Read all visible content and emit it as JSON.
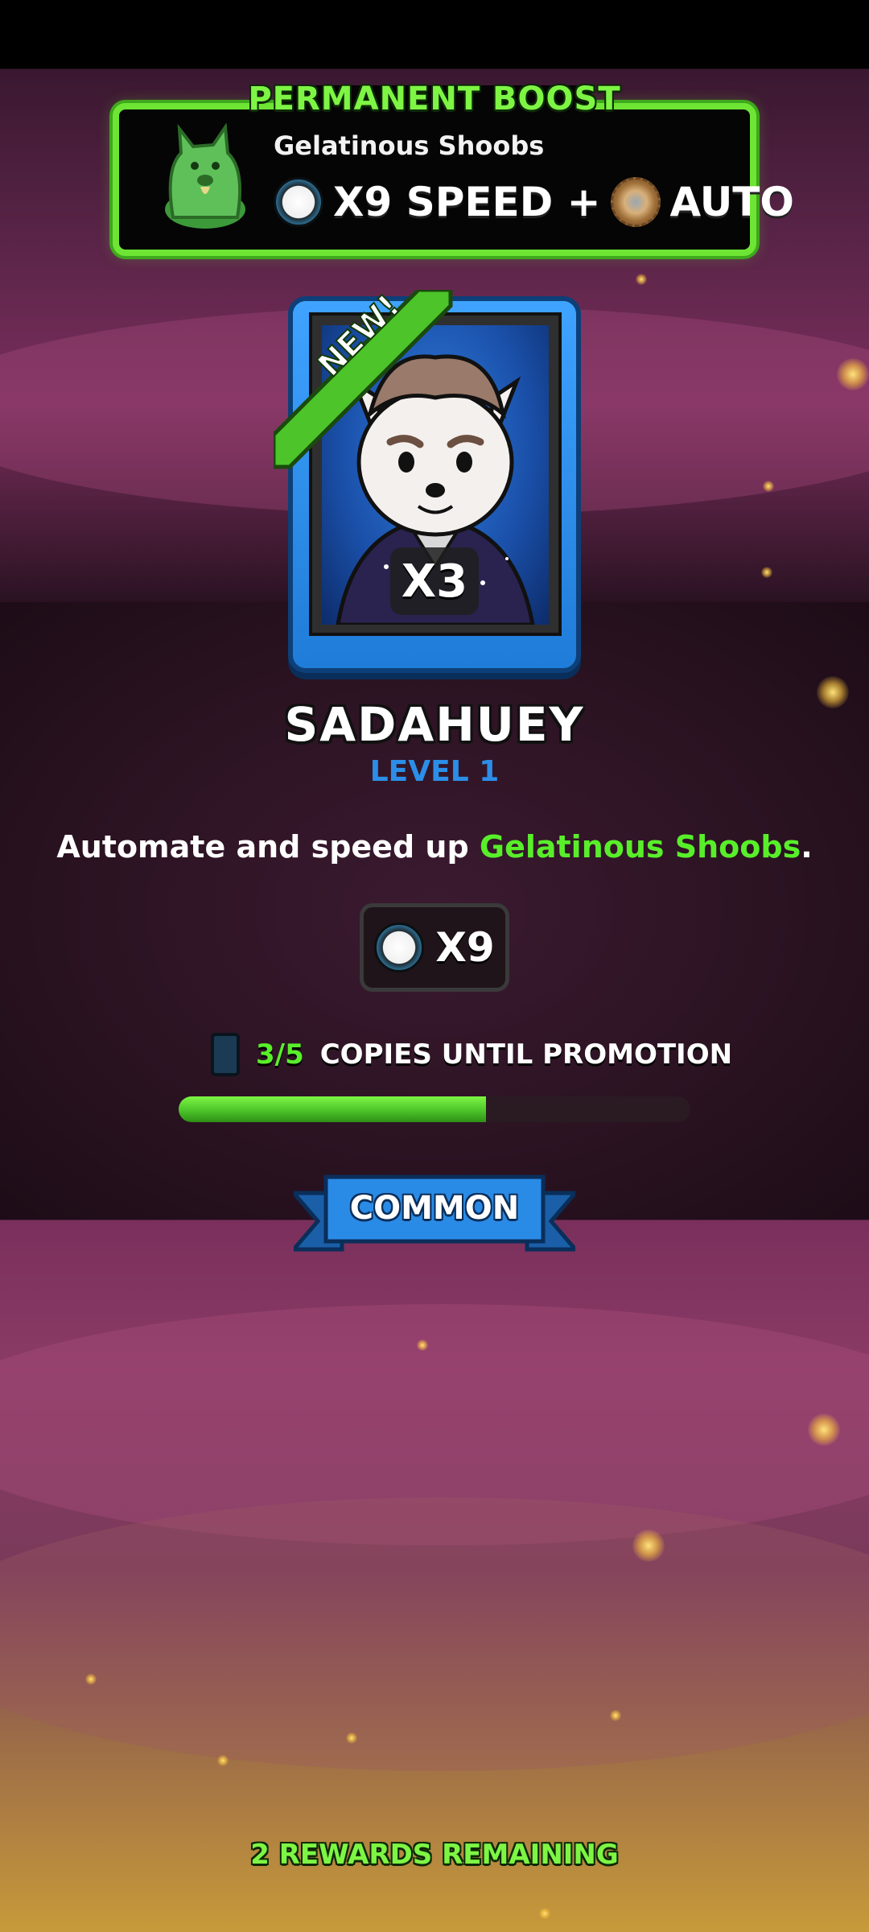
{
  "boost_panel": {
    "title": "PERMANENT BOOST",
    "shoob_name": "Gelatinous Shoobs",
    "speed_text": "X9 SPEED +",
    "auto_text": "AUTO",
    "speed_icon": "speedometer-icon",
    "auto_icon": "gear-icon",
    "accent_color": "#6ee534"
  },
  "card": {
    "new_badge": "NEW!",
    "copies_badge": "X3",
    "frame_color": "#1f7cd8",
    "character_icon": "white-fox-character-art"
  },
  "character": {
    "name": "SADAHUEY",
    "level": "LEVEL 1"
  },
  "description": {
    "prefix": "Automate and speed up ",
    "highlight": "Gelatinous Shoobs",
    "suffix": ".",
    "highlight_color": "#58ef2a"
  },
  "speed_stat": {
    "icon": "speedometer-icon",
    "value": "X9"
  },
  "promotion": {
    "count": "3/5",
    "label": "COPIES UNTIL PROMOTION",
    "progress": 0.6,
    "card_icon": "card-icon"
  },
  "rarity": {
    "label": "COMMON",
    "color": "#2a8be6"
  },
  "footer": {
    "rewards_remaining": "2 REWARDS REMAINING"
  }
}
